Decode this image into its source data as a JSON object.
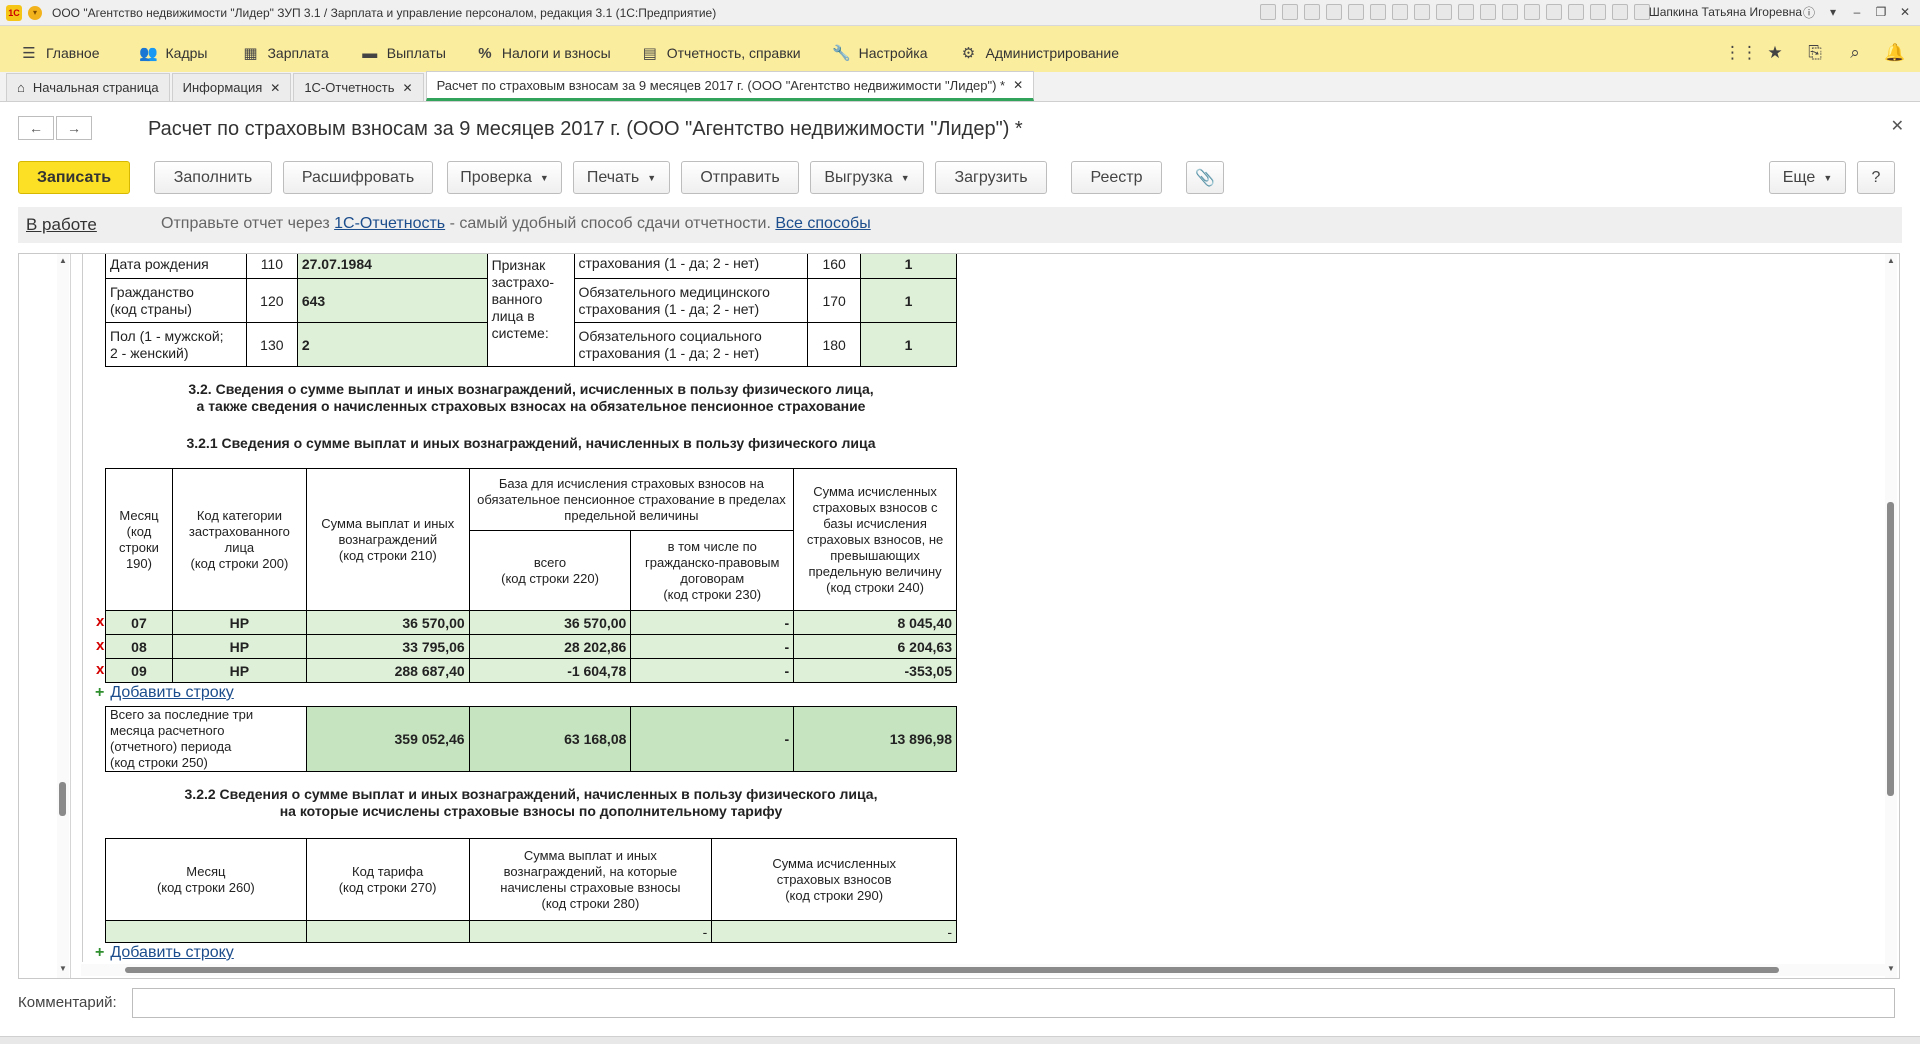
{
  "window": {
    "title": "ООО \"Агентство недвижимости \"Лидер\" ЗУП 3.1 / Зарплата и управление персоналом, редакция 3.1 (1С:Предприятие)",
    "user": "Шапкина Татьяна Игоревна",
    "logo": "1С"
  },
  "menu": {
    "items": [
      {
        "label": "Главное",
        "icon": "menu-icon"
      },
      {
        "label": "Кадры",
        "icon": "people-icon"
      },
      {
        "label": "Зарплата",
        "icon": "calculator-icon"
      },
      {
        "label": "Выплаты",
        "icon": "wallet-icon"
      },
      {
        "label": "Налоги и взносы",
        "icon": "percent-icon"
      },
      {
        "label": "Отчетность, справки",
        "icon": "report-icon"
      },
      {
        "label": "Настройка",
        "icon": "wrench-icon"
      },
      {
        "label": "Администрирование",
        "icon": "gear-icon"
      }
    ]
  },
  "tabs": [
    {
      "label": "Начальная страница"
    },
    {
      "label": "Информация"
    },
    {
      "label": "1С-Отчетность"
    },
    {
      "label": "Расчет по страховым взносам за 9 месяцев 2017 г. (ООО \"Агентство недвижимости \"Лидер\") *"
    }
  ],
  "form": {
    "title": "Расчет по страховым взносам за 9 месяцев 2017 г. (ООО \"Агентство недвижимости \"Лидер\") *",
    "buttons": {
      "save": "Записать",
      "fill": "Заполнить",
      "decode": "Расшифровать",
      "check": "Проверка",
      "print": "Печать",
      "send": "Отправить",
      "export": "Выгрузка",
      "import": "Загрузить",
      "registry": "Реестр",
      "more": "Еще",
      "help": "?"
    },
    "status": "В работе",
    "info_prefix": "Отправьте отчет через",
    "info_link": "1С-Отчетность",
    "info_middle": "- самый удобный способ сдачи отчетности.",
    "info_link2": "Все способы",
    "comment_label": "Комментарий:"
  },
  "personal": {
    "rows": [
      {
        "label": "Дата рождения",
        "code": "110",
        "value": "27.07.1984"
      },
      {
        "label": "Гражданство\n(код страны)",
        "code": "120",
        "value": "643"
      },
      {
        "label": "Пол (1 - мужской;\n2 - женский)",
        "code": "130",
        "value": "2"
      }
    ],
    "sign_label": "Признак\nзастрахо-\nванного\nлица в\nсистеме:",
    "insurance": [
      {
        "label": "страхования (1 - да; 2 - нет)",
        "code": "160",
        "value": "1"
      },
      {
        "label": "Обязательного медицинского\nстрахования (1 - да; 2 - нет)",
        "code": "170",
        "value": "1"
      },
      {
        "label": "Обязательного социального\nстрахования (1 - да; 2 - нет)",
        "code": "180",
        "value": "1"
      }
    ]
  },
  "section_3_2": {
    "title": "3.2. Сведения о сумме выплат и иных вознаграждений, исчисленных в пользу физического лица,\nа также сведения о начисленных страховых взносах на обязательное пенсионное страхование",
    "sub1_title": "3.2.1 Сведения о сумме выплат и иных вознаграждений, начисленных в пользу физического лица",
    "headers": {
      "month": "Месяц\n(код\nстроки\n190)",
      "category": "Код категории\nзастрахованного\nлица\n(код строки 200)",
      "payments": "Сумма выплат и иных\nвознаграждений\n(код строки 210)",
      "base": "База для исчисления страховых взносов на\nобязательное пенсионное страхование в пределах\nпредельной величины",
      "base_total": "всего\n(код строки 220)",
      "base_civil": "в том числе по\nгражданско-правовым\nдоговорам\n(код строки 230)",
      "contrib": "Сумма исчисленных\nстраховых взносов с\nбазы исчисления\nстраховых взносов, не\nпревышающих\nпредельную величину\n(код строки 240)"
    },
    "rows": [
      {
        "mark": "x",
        "month": "07",
        "category": "НР",
        "payments": "36 570,00",
        "base_total": "36 570,00",
        "base_civil": "-",
        "contrib": "8 045,40"
      },
      {
        "mark": "x",
        "month": "08",
        "category": "НР",
        "payments": "33 795,06",
        "base_total": "28 202,86",
        "base_civil": "-",
        "contrib": "6 204,63"
      },
      {
        "mark": "x",
        "month": "09",
        "category": "НР",
        "payments": "288 687,40",
        "base_total": "-1 604,78",
        "base_civil": "-",
        "contrib": "-353,05"
      }
    ],
    "add_row": "Добавить строку",
    "total": {
      "label": "Всего за последние три\nмесяца расчетного\n(отчетного) периода\n(код строки 250)",
      "payments": "359 052,46",
      "base_total": "63 168,08",
      "base_civil": "-",
      "contrib": "13 896,98"
    },
    "sub2_title": "3.2.2 Сведения о сумме выплат и иных вознаграждений, начисленных в пользу физического лица,\nна которые исчислены страховые взносы по дополнительному тарифу",
    "sub2_headers": {
      "month": "Месяц\n(код строки 260)",
      "tariff": "Код тарифа\n(код строки 270)",
      "payments": "Сумма выплат и иных\nвознаграждений, на которые\nначислены страховые взносы\n(код строки 280)",
      "contrib": "Сумма исчисленных\nстраховых взносов\n(код строки 290)"
    },
    "sub2_row": {
      "month": "",
      "tariff": "",
      "payments": "-",
      "contrib": "-"
    },
    "add_row2": "Добавить строку"
  },
  "colors": {
    "menu_bg": "#fbed9e",
    "primary_button": "#fbe026",
    "green_cell": "#dff0d8",
    "active_tab": "#31a35a",
    "link": "#1c4d8c"
  }
}
